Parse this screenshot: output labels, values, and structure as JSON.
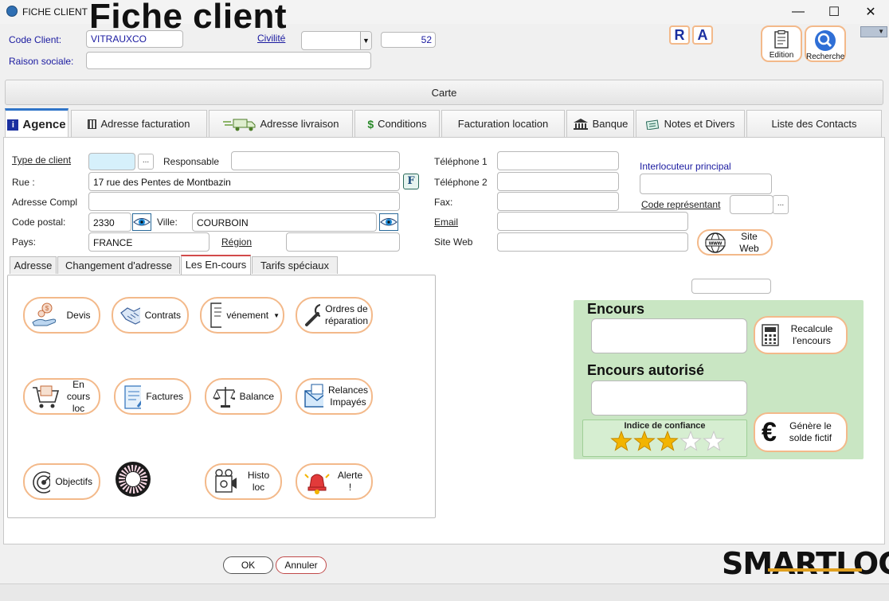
{
  "window": {
    "title": "FICHE CLIENT",
    "heading": "Fiche client",
    "minimize": "—",
    "maximize": "☐",
    "close": "✕"
  },
  "header": {
    "code_client_label": "Code Client:",
    "code_client_value": "VITRAUXCO",
    "civilite_label": "Civilité",
    "civilite_value": "",
    "number_value": "52",
    "raison_sociale_label": "Raison sociale:",
    "raison_sociale_value": "",
    "r_button": "R",
    "a_button": "A",
    "edition_label": "Edition",
    "recherche_label": "Recherche"
  },
  "carte_label": "Carte",
  "tabs": [
    {
      "label": "Agence",
      "icon": "info-icon"
    },
    {
      "label": "Adresse facturation",
      "icon": "building-icon"
    },
    {
      "label": "Adresse livraison",
      "icon": "truck-icon"
    },
    {
      "label": "Conditions",
      "icon": "dollar-icon"
    },
    {
      "label": "Facturation location",
      "icon": ""
    },
    {
      "label": "Banque",
      "icon": "bank-icon"
    },
    {
      "label": "Notes et Divers",
      "icon": "notes-icon"
    },
    {
      "label": "Liste des Contacts",
      "icon": ""
    }
  ],
  "form": {
    "type_client_label": "Type de client",
    "type_client_value": "",
    "responsable_label": "Responsable",
    "responsable_value": "",
    "rue_label": "Rue :",
    "rue_value": "17 rue des Pentes de Montbazin",
    "adresse_compl_label": "Adresse Compl",
    "adresse_compl_value": "",
    "code_postal_label": "Code postal:",
    "code_postal_value": "2330",
    "ville_label": "Ville:",
    "ville_value": "COURBOIN",
    "pays_label": "Pays:",
    "pays_value": "FRANCE",
    "region_label": "Région",
    "region_value": "",
    "tel1_label": "Téléphone 1",
    "tel1_value": "",
    "tel2_label": "Téléphone 2",
    "tel2_value": "",
    "fax_label": "Fax:",
    "fax_value": "",
    "email_label": "Email",
    "email_value": "",
    "site_web_label": "Site Web",
    "site_web_value": "",
    "site_web_button": "Site Web",
    "interlocuteur_label": "Interlocuteur principal",
    "interlocuteur_value": "",
    "code_representant_label": "Code représentant",
    "code_representant_value": "",
    "dots": "..."
  },
  "subtabs": [
    "Adresse",
    "Changement d'adresse",
    "Les En-cours",
    "Tarifs spéciaux"
  ],
  "encours_buttons": {
    "devis": "Devis",
    "contrats": "Contrats",
    "evenement": "vénement",
    "ordres_1": "Ordres de",
    "ordres_2": "réparation",
    "encours_loc_1": "En cours",
    "encours_loc_2": "loc",
    "factures": "Factures",
    "balance": "Balance",
    "relances_1": "Relances",
    "relances_2": "Impayés",
    "objectifs": "Objectifs",
    "histo_loc": "Histo loc",
    "alerte": "Alerte !"
  },
  "encours": {
    "encours_title": "Encours",
    "encours_value": "",
    "recalcule_1": "Recalcule",
    "recalcule_2": "l'encours",
    "autorise_title": "Encours autorisé",
    "autorise_value": "",
    "confiance_label": "Indice de confiance",
    "confiance_stars": 3,
    "confiance_max": 5,
    "genere_1": "Génère le",
    "genere_2": "solde fictif",
    "euro": "€"
  },
  "footer": {
    "ok": "OK",
    "annuler": "Annuler",
    "logo": "SMARTLOC"
  },
  "colors": {
    "accent_orange": "#f3b98a",
    "label_blue": "#1a1aa0",
    "tab_blue": "#2f74c8",
    "encours_green": "#c9e6c3",
    "star_gold": "#f2b400"
  }
}
